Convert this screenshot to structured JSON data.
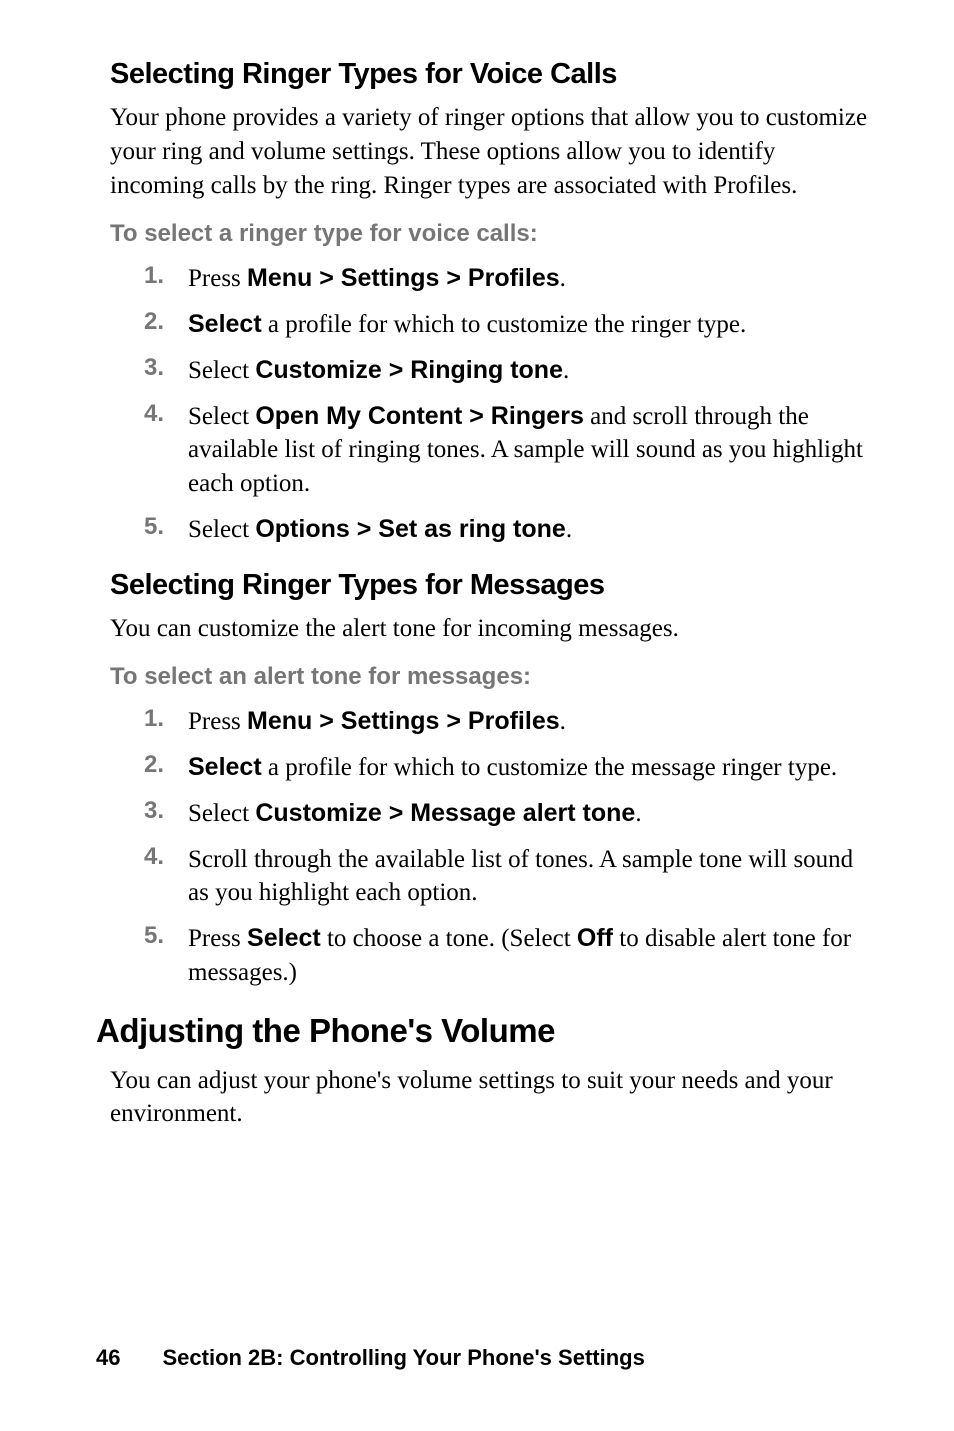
{
  "section1": {
    "heading": "Selecting Ringer Types for Voice Calls",
    "paragraph": "Your phone provides a variety of ringer options that allow you to customize your ring and volume settings. These options allow you to identify incoming calls by the ring. Ringer types are associated with Profiles.",
    "instruction": "To select a ringer type for voice calls:",
    "steps": [
      {
        "num": "1.",
        "pre": "Press ",
        "bold": "Menu > Settings > Profiles",
        "post": "."
      },
      {
        "num": "2.",
        "pre": "",
        "bold": "Select",
        "post": " a profile for which to customize the ringer type."
      },
      {
        "num": "3.",
        "pre": "Select ",
        "bold": "Customize > Ringing tone",
        "post": "."
      },
      {
        "num": "4.",
        "pre": "Select ",
        "bold": "Open My Content > Ringers",
        "post": " and scroll through the available list of ringing tones. A sample will sound as you highlight each option."
      },
      {
        "num": "5.",
        "pre": "Select ",
        "bold": "Options > Set as ring tone",
        "post": "."
      }
    ]
  },
  "section2": {
    "heading": "Selecting Ringer Types for Messages",
    "paragraph": "You can customize the alert tone for incoming messages.",
    "instruction": "To select an alert tone for messages:",
    "steps": [
      {
        "num": "1.",
        "pre": "Press ",
        "bold": "Menu > Settings > Profiles",
        "post": "."
      },
      {
        "num": "2.",
        "pre": "",
        "bold": "Select",
        "post": " a profile for which to customize the message ringer type."
      },
      {
        "num": "3.",
        "pre": "Select ",
        "bold": "Customize > Message alert tone",
        "post": "."
      },
      {
        "num": "4.",
        "pre": "Scroll through the available list of tones. A sample tone will sound as you highlight each option.",
        "bold": "",
        "post": ""
      },
      {
        "num": "5.",
        "pre": "Press ",
        "bold": "Select",
        "mid": " to choose a tone. (Select ",
        "bold2": "Off",
        "post": " to disable alert tone for messages.)"
      }
    ]
  },
  "section3": {
    "heading": "Adjusting the Phone's Volume",
    "paragraph": "You can adjust your phone's volume settings to suit your needs and your environment."
  },
  "footer": {
    "page": "46",
    "title": "Section 2B: Controlling Your Phone's Settings"
  }
}
